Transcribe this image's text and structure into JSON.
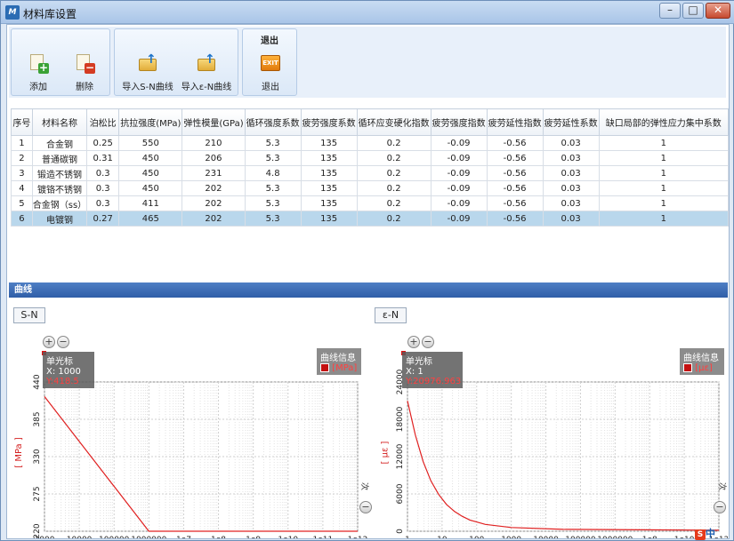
{
  "window": {
    "title": "材料库设置",
    "icon": "app-logo-icon"
  },
  "ribbon": {
    "groups": [
      {
        "buttons": [
          {
            "label": "添加",
            "icon": "add-sheet-icon"
          },
          {
            "label": "删除",
            "icon": "delete-sheet-icon"
          }
        ]
      },
      {
        "buttons": [
          {
            "label": "导入S-N曲线",
            "icon": "import-folder-icon"
          },
          {
            "label": "导入ε-N曲线",
            "icon": "import-folder-icon"
          }
        ]
      },
      {
        "title": "退出",
        "buttons": [
          {
            "label": "退出",
            "icon": "exit-icon",
            "badge": "EXIT"
          }
        ]
      }
    ]
  },
  "table": {
    "columns": [
      "序号",
      "材料名称",
      "泊松比",
      "抗拉强度(MPa)",
      "弹性模量(GPa)",
      "循环强度系数",
      "疲劳强度系数",
      "循环应变硬化指数",
      "疲劳强度指数",
      "疲劳延性指数",
      "疲劳延性系数",
      "缺口局部的弹性应力集中系数"
    ],
    "rows": [
      [
        "1",
        "合金钢",
        "0.25",
        "550",
        "210",
        "5.3",
        "135",
        "0.2",
        "-0.09",
        "-0.56",
        "0.03",
        "1"
      ],
      [
        "2",
        "普通碳钢",
        "0.31",
        "450",
        "206",
        "5.3",
        "135",
        "0.2",
        "-0.09",
        "-0.56",
        "0.03",
        "1"
      ],
      [
        "3",
        "锻造不锈钢",
        "0.3",
        "450",
        "231",
        "4.8",
        "135",
        "0.2",
        "-0.09",
        "-0.56",
        "0.03",
        "1"
      ],
      [
        "4",
        "镀铬不锈钢",
        "0.3",
        "450",
        "202",
        "5.3",
        "135",
        "0.2",
        "-0.09",
        "-0.56",
        "0.03",
        "1"
      ],
      [
        "5",
        "合金钢（ss）",
        "0.3",
        "411",
        "202",
        "5.3",
        "135",
        "0.2",
        "-0.09",
        "-0.56",
        "0.03",
        "1"
      ],
      [
        "6",
        "电镀钢",
        "0.27",
        "465",
        "202",
        "5.3",
        "135",
        "0.2",
        "-0.09",
        "-0.56",
        "0.03",
        "1"
      ]
    ],
    "selected_row": 5
  },
  "curves": {
    "section_title": "曲线",
    "sn": {
      "tab": "S-N",
      "cursor_title": "单光标",
      "cursor_x": "X: 1000",
      "cursor_y": "Y:418.5",
      "legend_title": "曲线信息",
      "legend_unit": "[MPa]",
      "axis_title": "[ MPa ]",
      "x_unit": "次"
    },
    "en": {
      "tab": "ε-N",
      "cursor_title": "单光标",
      "cursor_x": "X: 1",
      "cursor_y": "Y:20976.963",
      "legend_title": "曲线信息",
      "legend_unit": "[με]",
      "axis_title": "[ με ]",
      "x_unit": "次"
    }
  },
  "chart_data": [
    {
      "type": "line",
      "xscale": "log",
      "x": [
        1000,
        1000000,
        1000000000000
      ],
      "series": [
        {
          "values": [
            418.5,
            220,
            220
          ]
        }
      ],
      "xticks": [
        "1000",
        "10000",
        "100000",
        "1000000",
        "1e7",
        "1e8",
        "1e9",
        "1e10",
        "1e11",
        "1e12"
      ],
      "yticks": [
        "220",
        "275",
        "330",
        "385",
        "440"
      ],
      "ylim": [
        220,
        440
      ],
      "ylabel": "[ MPa ]",
      "grid": true,
      "color": "#e02020"
    },
    {
      "type": "line",
      "xscale": "log",
      "x": [
        1,
        2,
        4,
        8,
        16,
        32,
        64,
        128,
        256,
        1000,
        10000,
        1000000,
        1000000000000
      ],
      "series": [
        {
          "values": [
            20976.963,
            15500,
            11200,
            8100,
            5900,
            4300,
            3200,
            2400,
            1800,
            1100,
            600,
            300,
            150
          ]
        }
      ],
      "xticks": [
        "1",
        "10",
        "100",
        "1000",
        "10000",
        "100000",
        "1000000",
        "1e8",
        "1e10",
        "1e12"
      ],
      "yticks": [
        "0",
        "6000",
        "12000",
        "18000",
        "24000"
      ],
      "ylim": [
        0,
        24000
      ],
      "ylabel": "[ με ]",
      "grid": true,
      "color": "#e02020"
    }
  ],
  "tray": {
    "label": "中"
  }
}
